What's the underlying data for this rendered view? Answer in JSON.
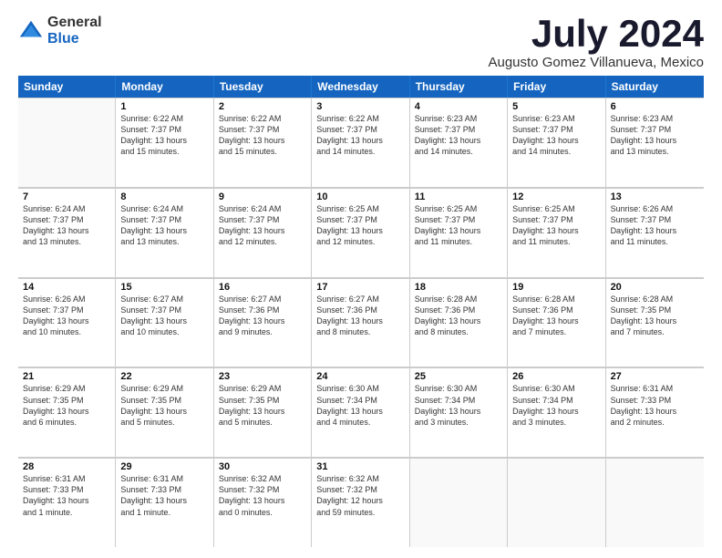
{
  "logo": {
    "general": "General",
    "blue": "Blue"
  },
  "header": {
    "month": "July 2024",
    "location": "Augusto Gomez Villanueva, Mexico"
  },
  "weekdays": [
    "Sunday",
    "Monday",
    "Tuesday",
    "Wednesday",
    "Thursday",
    "Friday",
    "Saturday"
  ],
  "weeks": [
    [
      {
        "date": "",
        "info": ""
      },
      {
        "date": "1",
        "info": "Sunrise: 6:22 AM\nSunset: 7:37 PM\nDaylight: 13 hours\nand 15 minutes."
      },
      {
        "date": "2",
        "info": "Sunrise: 6:22 AM\nSunset: 7:37 PM\nDaylight: 13 hours\nand 15 minutes."
      },
      {
        "date": "3",
        "info": "Sunrise: 6:22 AM\nSunset: 7:37 PM\nDaylight: 13 hours\nand 14 minutes."
      },
      {
        "date": "4",
        "info": "Sunrise: 6:23 AM\nSunset: 7:37 PM\nDaylight: 13 hours\nand 14 minutes."
      },
      {
        "date": "5",
        "info": "Sunrise: 6:23 AM\nSunset: 7:37 PM\nDaylight: 13 hours\nand 14 minutes."
      },
      {
        "date": "6",
        "info": "Sunrise: 6:23 AM\nSunset: 7:37 PM\nDaylight: 13 hours\nand 13 minutes."
      }
    ],
    [
      {
        "date": "7",
        "info": "Sunrise: 6:24 AM\nSunset: 7:37 PM\nDaylight: 13 hours\nand 13 minutes."
      },
      {
        "date": "8",
        "info": "Sunrise: 6:24 AM\nSunset: 7:37 PM\nDaylight: 13 hours\nand 13 minutes."
      },
      {
        "date": "9",
        "info": "Sunrise: 6:24 AM\nSunset: 7:37 PM\nDaylight: 13 hours\nand 12 minutes."
      },
      {
        "date": "10",
        "info": "Sunrise: 6:25 AM\nSunset: 7:37 PM\nDaylight: 13 hours\nand 12 minutes."
      },
      {
        "date": "11",
        "info": "Sunrise: 6:25 AM\nSunset: 7:37 PM\nDaylight: 13 hours\nand 11 minutes."
      },
      {
        "date": "12",
        "info": "Sunrise: 6:25 AM\nSunset: 7:37 PM\nDaylight: 13 hours\nand 11 minutes."
      },
      {
        "date": "13",
        "info": "Sunrise: 6:26 AM\nSunset: 7:37 PM\nDaylight: 13 hours\nand 11 minutes."
      }
    ],
    [
      {
        "date": "14",
        "info": "Sunrise: 6:26 AM\nSunset: 7:37 PM\nDaylight: 13 hours\nand 10 minutes."
      },
      {
        "date": "15",
        "info": "Sunrise: 6:27 AM\nSunset: 7:37 PM\nDaylight: 13 hours\nand 10 minutes."
      },
      {
        "date": "16",
        "info": "Sunrise: 6:27 AM\nSunset: 7:36 PM\nDaylight: 13 hours\nand 9 minutes."
      },
      {
        "date": "17",
        "info": "Sunrise: 6:27 AM\nSunset: 7:36 PM\nDaylight: 13 hours\nand 8 minutes."
      },
      {
        "date": "18",
        "info": "Sunrise: 6:28 AM\nSunset: 7:36 PM\nDaylight: 13 hours\nand 8 minutes."
      },
      {
        "date": "19",
        "info": "Sunrise: 6:28 AM\nSunset: 7:36 PM\nDaylight: 13 hours\nand 7 minutes."
      },
      {
        "date": "20",
        "info": "Sunrise: 6:28 AM\nSunset: 7:35 PM\nDaylight: 13 hours\nand 7 minutes."
      }
    ],
    [
      {
        "date": "21",
        "info": "Sunrise: 6:29 AM\nSunset: 7:35 PM\nDaylight: 13 hours\nand 6 minutes."
      },
      {
        "date": "22",
        "info": "Sunrise: 6:29 AM\nSunset: 7:35 PM\nDaylight: 13 hours\nand 5 minutes."
      },
      {
        "date": "23",
        "info": "Sunrise: 6:29 AM\nSunset: 7:35 PM\nDaylight: 13 hours\nand 5 minutes."
      },
      {
        "date": "24",
        "info": "Sunrise: 6:30 AM\nSunset: 7:34 PM\nDaylight: 13 hours\nand 4 minutes."
      },
      {
        "date": "25",
        "info": "Sunrise: 6:30 AM\nSunset: 7:34 PM\nDaylight: 13 hours\nand 3 minutes."
      },
      {
        "date": "26",
        "info": "Sunrise: 6:30 AM\nSunset: 7:34 PM\nDaylight: 13 hours\nand 3 minutes."
      },
      {
        "date": "27",
        "info": "Sunrise: 6:31 AM\nSunset: 7:33 PM\nDaylight: 13 hours\nand 2 minutes."
      }
    ],
    [
      {
        "date": "28",
        "info": "Sunrise: 6:31 AM\nSunset: 7:33 PM\nDaylight: 13 hours\nand 1 minute."
      },
      {
        "date": "29",
        "info": "Sunrise: 6:31 AM\nSunset: 7:33 PM\nDaylight: 13 hours\nand 1 minute."
      },
      {
        "date": "30",
        "info": "Sunrise: 6:32 AM\nSunset: 7:32 PM\nDaylight: 13 hours\nand 0 minutes."
      },
      {
        "date": "31",
        "info": "Sunrise: 6:32 AM\nSunset: 7:32 PM\nDaylight: 12 hours\nand 59 minutes."
      },
      {
        "date": "",
        "info": ""
      },
      {
        "date": "",
        "info": ""
      },
      {
        "date": "",
        "info": ""
      }
    ]
  ]
}
